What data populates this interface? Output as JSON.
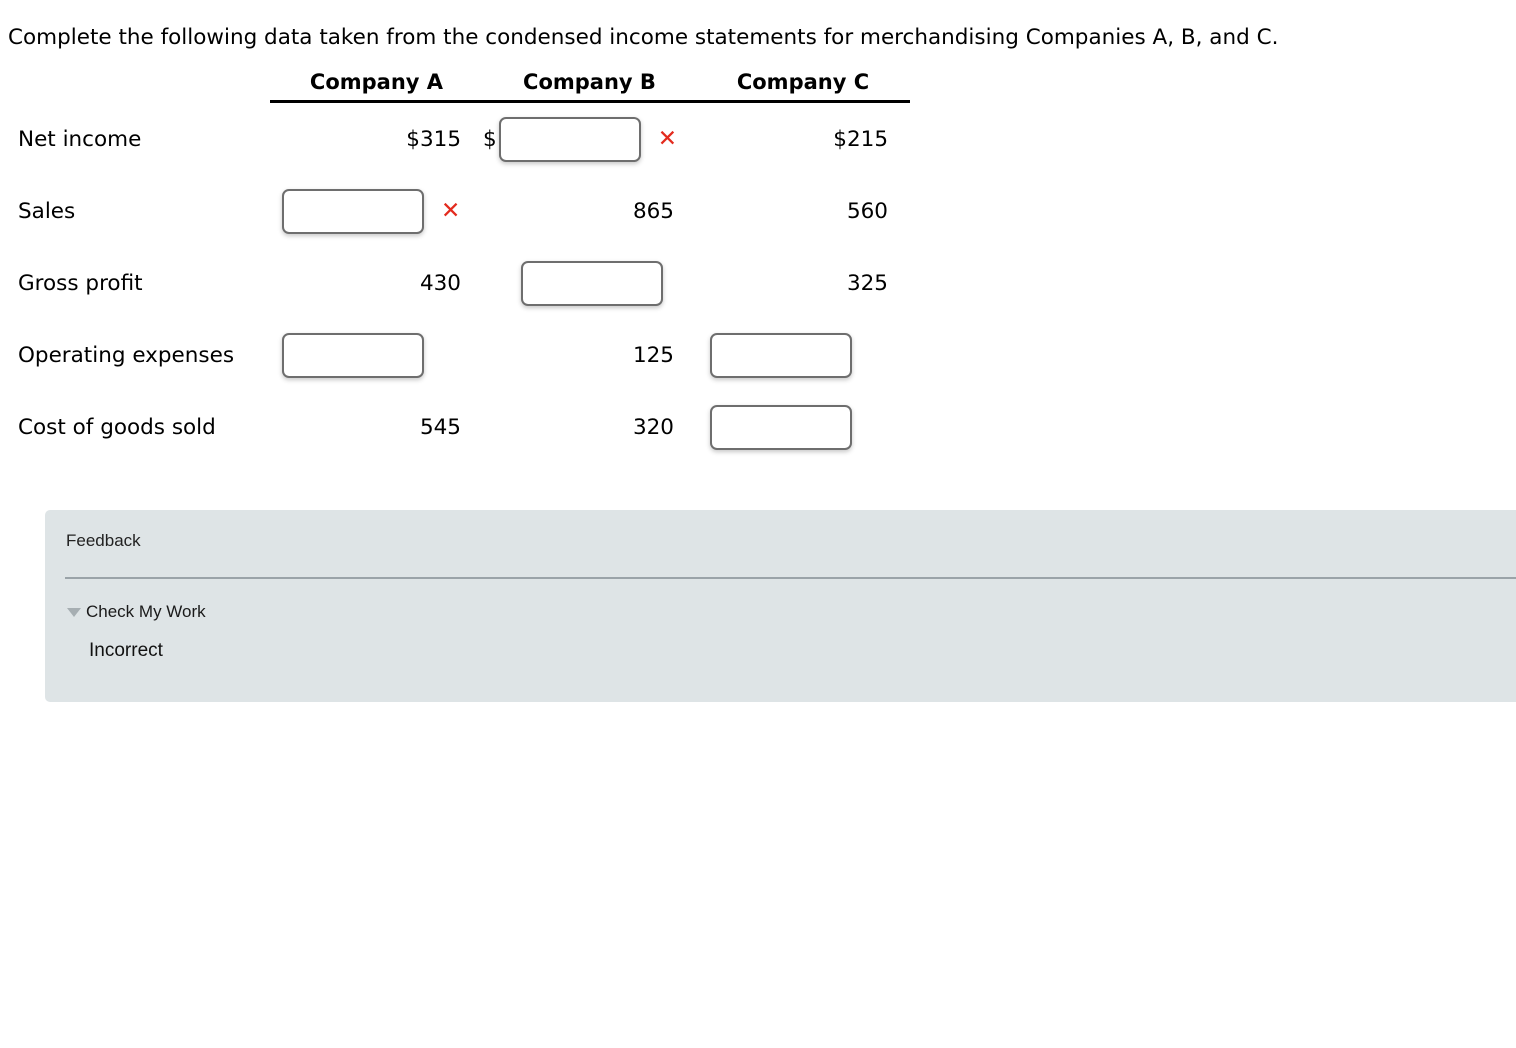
{
  "prompt": "Complete the following data taken from the condensed income statements for merchandising Companies A, B, and C.",
  "table": {
    "columns": [
      "Company A",
      "Company B",
      "Company C"
    ],
    "row_label_header": "",
    "rows": [
      {
        "label": "Net income",
        "a": {
          "type": "value",
          "text": "$315"
        },
        "b": {
          "type": "input",
          "value": "",
          "prefix": "$",
          "mark": "✕"
        },
        "c": {
          "type": "value",
          "text": "$215"
        }
      },
      {
        "label": "Sales",
        "a": {
          "type": "input",
          "value": "",
          "prefix": "",
          "mark": "✕"
        },
        "b": {
          "type": "value",
          "text": "865"
        },
        "c": {
          "type": "value",
          "text": "560"
        }
      },
      {
        "label": "Gross profit",
        "a": {
          "type": "value",
          "text": "430"
        },
        "b": {
          "type": "input",
          "value": "",
          "prefix": "",
          "mark": ""
        },
        "c": {
          "type": "value",
          "text": "325"
        }
      },
      {
        "label": "Operating expenses",
        "a": {
          "type": "input",
          "value": "",
          "prefix": "",
          "mark": ""
        },
        "b": {
          "type": "value",
          "text": "125"
        },
        "c": {
          "type": "input",
          "value": "",
          "prefix": "",
          "mark": ""
        }
      },
      {
        "label": "Cost of goods sold",
        "a": {
          "type": "value",
          "text": "545"
        },
        "b": {
          "type": "value",
          "text": "320"
        },
        "c": {
          "type": "input",
          "value": "",
          "prefix": "",
          "mark": ""
        }
      }
    ]
  },
  "feedback": {
    "title": "Feedback",
    "toggle_label": "Check My Work",
    "result": "Incorrect",
    "caret_icon": "triangle-down-icon",
    "background_color": "#dee4e6"
  },
  "colors": {
    "incorrect_mark": "#e32b1e",
    "input_border": "#6e6e6e",
    "rule": "#000000",
    "feedback_bg": "#dee4e6",
    "feedback_rule": "#9aa3a8"
  }
}
